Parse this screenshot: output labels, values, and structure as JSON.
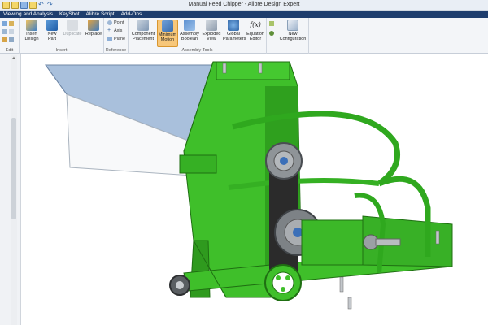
{
  "window": {
    "title": "Manual Feed Chipper - Alibre Design Expert"
  },
  "menu": {
    "items": [
      "Viewing and Analysis",
      "KeyShot",
      "Alibre Script",
      "Add-Ons"
    ]
  },
  "ribbon": {
    "groups": {
      "edit": "Edit",
      "insert": "Insert",
      "reference": "Reference",
      "assembly_tools": "Assembly Tools"
    },
    "buttons": {
      "insert_design": "Insert Design",
      "new_part": "New Part",
      "duplicate": "Duplicate",
      "replace": "Replace",
      "point": "Point",
      "axis": "Axis",
      "plane": "Plane",
      "component_placement": "Component Placement",
      "minimum_motion": "Minimum Motion",
      "assembly_boolean": "Assembly Boolean",
      "exploded_view": "Exploded View",
      "global_parameters": "Global Parameters",
      "equation_editor": "Equation Editor",
      "new_configuration": "New Configuration"
    },
    "equation_symbol": "f(x)"
  },
  "colors": {
    "menubar": "#1e3d6d",
    "model_green": "#3fbf2a",
    "model_green_dark": "#2a8f1c",
    "hopper": "#a9c0dc",
    "active_button": "#f7c77a"
  },
  "icons": {
    "quick_access": [
      "new-icon",
      "open-icon",
      "save-icon",
      "undo-icon",
      "redo-icon"
    ]
  }
}
